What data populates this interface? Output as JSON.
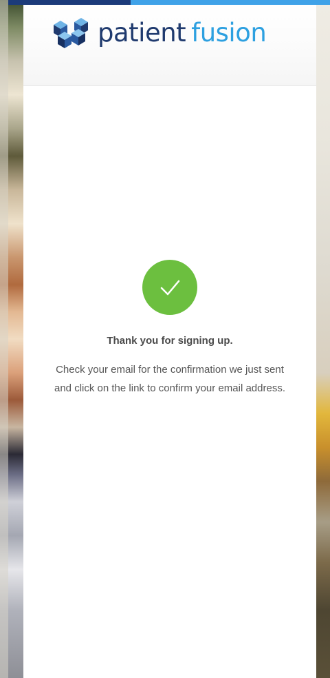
{
  "brand": {
    "name_part1": "patient",
    "name_part2": "fusion",
    "color_primary": "#1f3a6e",
    "color_accent": "#2da0e0"
  },
  "progress": {
    "fraction": 0.38,
    "color_done": "#1c3b7a",
    "color_remaining": "#3fa2e8"
  },
  "confirmation": {
    "icon": "checkmark-icon",
    "icon_color": "#6cbf3f",
    "title": "Thank you for signing up.",
    "message": "Check your email for the confirmation we just sent and click on the link to confirm your email address."
  }
}
